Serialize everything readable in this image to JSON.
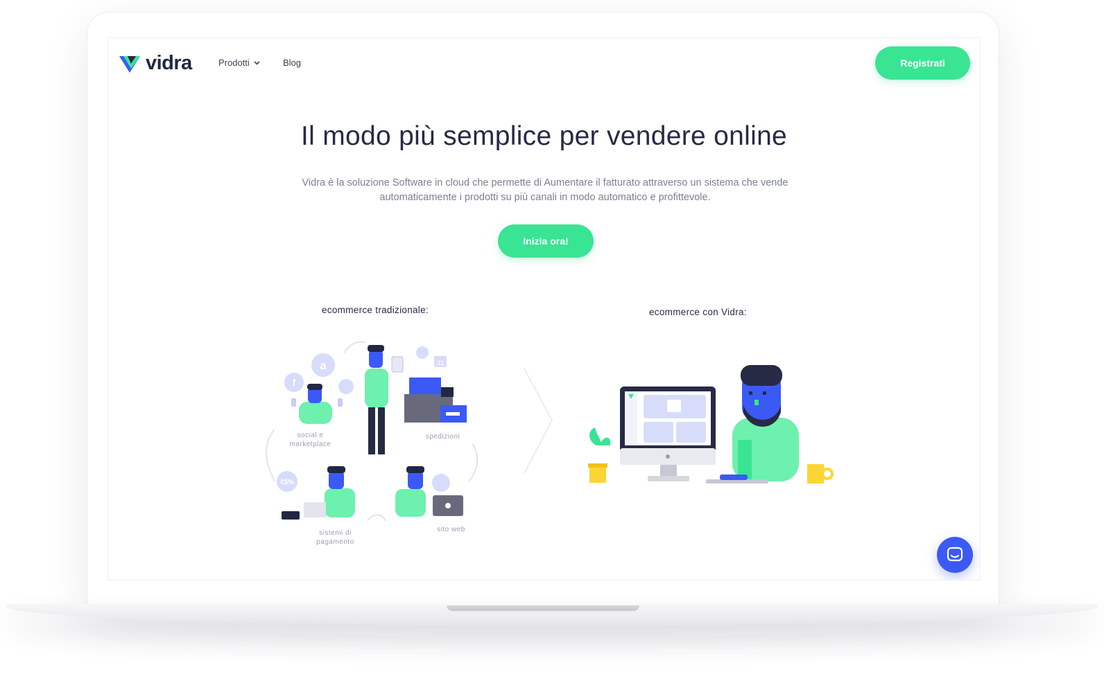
{
  "brand": {
    "name": "vidra",
    "colors": {
      "green": "#39e493",
      "blue": "#3b5af5",
      "navy": "#262a45"
    }
  },
  "nav": {
    "items": [
      {
        "label": "Prodotti",
        "icon": "chevron-down-icon"
      },
      {
        "label": "Blog"
      }
    ],
    "signup_label": "Registrati"
  },
  "hero": {
    "title": "Il modo più semplice per vendere online",
    "subtitle_line1": "Vidra è la soluzione Software in cloud che permette di Aumentare il fatturato attraverso un sistema che vende",
    "subtitle_line2": "automaticamente i prodotti su più canali in modo automatico e profittevole.",
    "cta_label": "Inizia ora!"
  },
  "comparison": {
    "left_title": "ecommerce tradizionale:",
    "right_title": "ecommerce con Vidra:",
    "labels": {
      "social_line1": "social e",
      "social_line2": "marketplace",
      "shipping": "spedizioni",
      "payments_line1": "sistemi di",
      "payments_line2": "pagamento",
      "website": "sito web",
      "payment_badge": "€$%",
      "calendar_day": "31"
    }
  },
  "chat": {
    "icon": "chat-icon"
  }
}
